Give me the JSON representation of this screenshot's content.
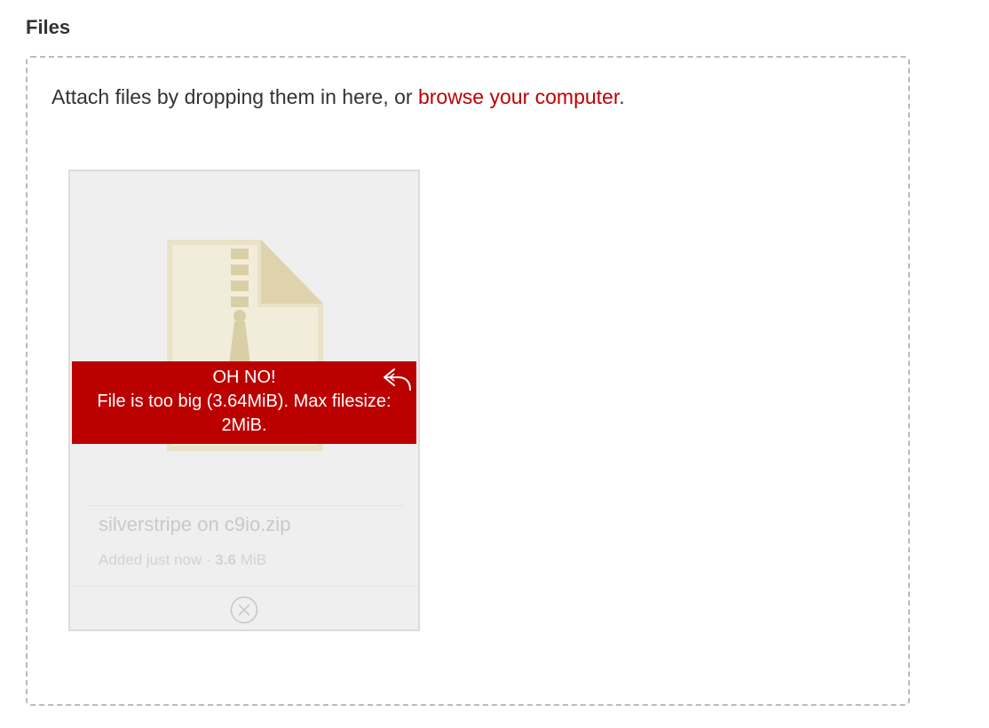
{
  "section": {
    "title": "Files"
  },
  "dropzone": {
    "instruction_prefix": "Attach files by dropping them in here, or ",
    "browse_link": "browse your computer",
    "instruction_suffix": "."
  },
  "file": {
    "icon": "zip-file-icon",
    "error_title": "OH NO!",
    "error_message": "File is too big (3.64MiB). Max filesize: 2MiB.",
    "retry_icon": "reply-arrow-icon",
    "name": "silverstripe on c9io.zip",
    "added_text": "Added just now",
    "separator": " · ",
    "size": "3.6",
    "size_unit": " MiB",
    "remove_icon": "circle-x-icon"
  },
  "colors": {
    "accent": "#c00000",
    "error_bg": "#bb0000",
    "card_bg": "#efefef",
    "zip_icon": "#e8dfc0"
  }
}
